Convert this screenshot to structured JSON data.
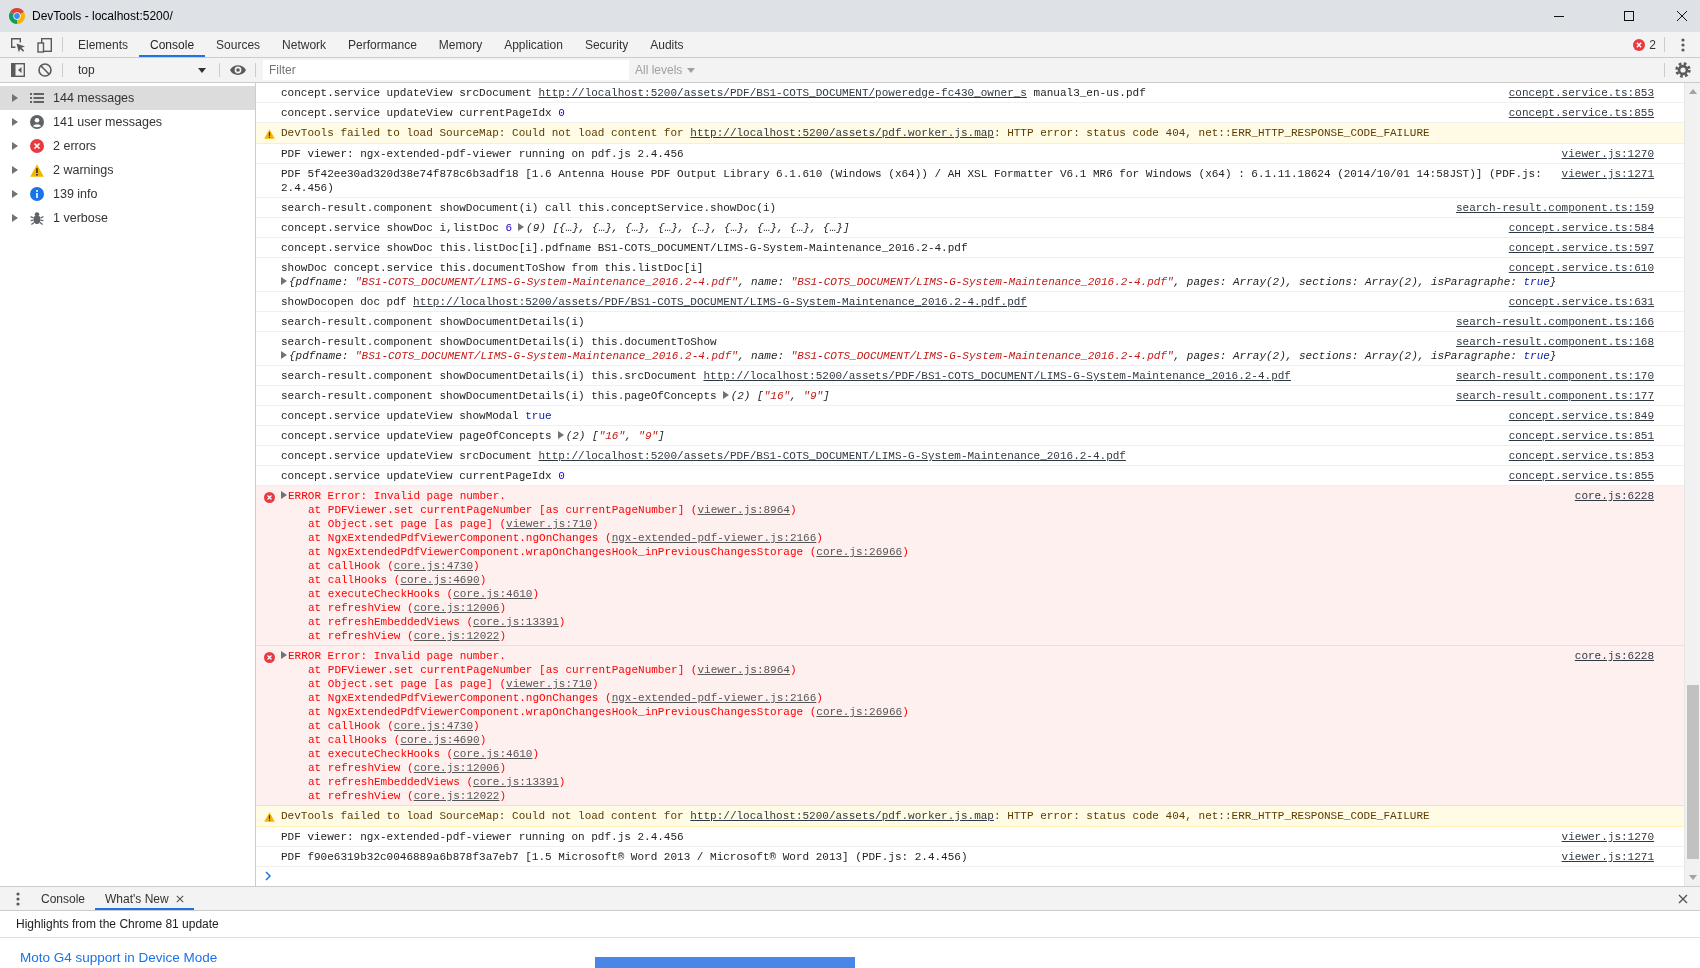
{
  "window": {
    "title": "DevTools - localhost:5200/"
  },
  "tabs": [
    {
      "label": "Elements",
      "selected": false
    },
    {
      "label": "Console",
      "selected": true
    },
    {
      "label": "Sources",
      "selected": false
    },
    {
      "label": "Network",
      "selected": false
    },
    {
      "label": "Performance",
      "selected": false
    },
    {
      "label": "Memory",
      "selected": false
    },
    {
      "label": "Application",
      "selected": false
    },
    {
      "label": "Security",
      "selected": false
    },
    {
      "label": "Audits",
      "selected": false
    }
  ],
  "error_badge": {
    "count": "2"
  },
  "toolbar": {
    "context": "top",
    "filter": {
      "placeholder": "Filter"
    },
    "levels": {
      "label": "All levels",
      "disabled": true
    }
  },
  "sidebar": {
    "items": [
      {
        "kind": "all",
        "label": "144 messages",
        "selected": true,
        "expanded": false
      },
      {
        "kind": "user",
        "label": "141 user messages",
        "selected": false,
        "expanded": false
      },
      {
        "kind": "error",
        "label": "2 errors",
        "selected": false,
        "expanded": false
      },
      {
        "kind": "warning",
        "label": "2 warnings",
        "selected": false,
        "expanded": false
      },
      {
        "kind": "info",
        "label": "139 info",
        "selected": false,
        "expanded": false
      },
      {
        "kind": "verbose",
        "label": "1 verbose",
        "selected": false,
        "expanded": false
      }
    ]
  },
  "messages": [
    {
      "kind": "log",
      "text": [
        {
          "kind": "plain",
          "text": "concept.service updateView srcDocument "
        },
        {
          "kind": "link",
          "text": "http://localhost:5200/assets/PDF/BS1-COTS_DOCUMENT/poweredge-fc430_owner_s"
        },
        {
          "kind": "plain",
          "text": " manual3_en-us.pdf"
        }
      ],
      "source": "concept.service.ts:853"
    },
    {
      "kind": "log",
      "text": [
        {
          "kind": "plain",
          "text": "concept.service updateView currentPageIdx "
        },
        {
          "kind": "number",
          "text": "0"
        }
      ],
      "source": "concept.service.ts:855"
    },
    {
      "kind": "warning",
      "text": [
        {
          "kind": "plain",
          "text": "DevTools failed to load SourceMap: Could not load content for "
        },
        {
          "kind": "link",
          "text": "http://localhost:5200/assets/pdf.worker.js.map"
        },
        {
          "kind": "plain",
          "text": ": HTTP error: status code 404, net::ERR_HTTP_RESPONSE_CODE_FAILURE"
        }
      ]
    },
    {
      "kind": "log",
      "text": [
        {
          "kind": "plain",
          "text": "PDF viewer: ngx-extended-pdf-viewer running on pdf.js 2.4.456"
        }
      ],
      "source": "viewer.js:1270"
    },
    {
      "kind": "log",
      "text": [
        {
          "kind": "plain",
          "text": "PDF 5f42ee30ad320d38e74f878c6b3adf18 [1.6 Antenna House PDF Output Library 6.1.610 (Windows (x64)) / AH XSL Formatter V6.1 MR6 for Windows (x64) : 6.1.11.18624 (2014/10/01 14:58JST)] (PDF.js: 2.4.456)"
        }
      ],
      "source": "viewer.js:1271"
    },
    {
      "kind": "log",
      "text": [
        {
          "kind": "plain",
          "text": "search-result.component showDocument(i) call this.conceptService.showDoc(i)"
        }
      ],
      "source": "search-result.component.ts:159"
    },
    {
      "kind": "log",
      "text": [
        {
          "kind": "plain",
          "text": "concept.service showDoc i,listDoc "
        },
        {
          "kind": "number",
          "text": "6"
        }
      ],
      "preview": {
        "expanded": false,
        "parts": [
          {
            "kind": "plain",
            "text": "(9) [{…}, {…}, {…}, {…}, {…}, {…}, {…}, {…}, {…}]"
          }
        ]
      },
      "source": "concept.service.ts:584"
    },
    {
      "kind": "log",
      "text": [
        {
          "kind": "plain",
          "text": "concept.service showDoc this.listDoc[i].pdfname BS1-COTS_DOCUMENT/LIMS-G-System-Maintenance_2016.2-4.pdf"
        }
      ],
      "source": "concept.service.ts:597"
    },
    {
      "kind": "log",
      "text": [
        {
          "kind": "plain",
          "text": "showDoc concept.service this.documentToShow from this.listDoc[i]"
        }
      ],
      "detail": {
        "expanded": false,
        "parts": [
          {
            "kind": "plain",
            "text": "{pdfname: "
          },
          {
            "kind": "string",
            "text": "\"BS1-COTS_DOCUMENT/LIMS-G-System-Maintenance_2016.2-4.pdf\""
          },
          {
            "kind": "plain",
            "text": ", name: "
          },
          {
            "kind": "string",
            "text": "\"BS1-COTS_DOCUMENT/LIMS-G-System-Maintenance_2016.2-4.pdf\""
          },
          {
            "kind": "plain",
            "text": ", pages: Array(2), sections: Array(2), isParagraphe: "
          },
          {
            "kind": "keyword",
            "text": "true"
          },
          {
            "kind": "plain",
            "text": "}"
          }
        ]
      },
      "source": "concept.service.ts:610"
    },
    {
      "kind": "log",
      "text": [
        {
          "kind": "plain",
          "text": "showDocopen doc pdf "
        },
        {
          "kind": "link",
          "text": "http://localhost:5200/assets/PDF/BS1-COTS_DOCUMENT/LIMS-G-System-Maintenance_2016.2-4.pdf.pdf"
        }
      ],
      "source": "concept.service.ts:631"
    },
    {
      "kind": "log",
      "text": [
        {
          "kind": "plain",
          "text": "search-result.component showDocumentDetails(i)"
        }
      ],
      "source": "search-result.component.ts:166"
    },
    {
      "kind": "log",
      "text": [
        {
          "kind": "plain",
          "text": "search-result.component showDocumentDetails(i) this.documentToShow"
        }
      ],
      "detail": {
        "expanded": false,
        "parts": [
          {
            "kind": "plain",
            "text": "{pdfname: "
          },
          {
            "kind": "string",
            "text": "\"BS1-COTS_DOCUMENT/LIMS-G-System-Maintenance_2016.2-4.pdf\""
          },
          {
            "kind": "plain",
            "text": ", name: "
          },
          {
            "kind": "string",
            "text": "\"BS1-COTS_DOCUMENT/LIMS-G-System-Maintenance_2016.2-4.pdf\""
          },
          {
            "kind": "plain",
            "text": ", pages: Array(2), sections: Array(2), isParagraphe: "
          },
          {
            "kind": "keyword",
            "text": "true"
          },
          {
            "kind": "plain",
            "text": "}"
          }
        ]
      },
      "source": "search-result.component.ts:168"
    },
    {
      "kind": "log",
      "text": [
        {
          "kind": "plain",
          "text": "search-result.component showDocumentDetails(i) this.srcDocument "
        },
        {
          "kind": "link",
          "text": "http://localhost:5200/assets/PDF/BS1-COTS_DOCUMENT/LIMS-G-System-Maintenance_2016.2-4.pdf"
        }
      ],
      "source": "search-result.component.ts:170"
    },
    {
      "kind": "log",
      "text": [
        {
          "kind": "plain",
          "text": "search-result.component showDocumentDetails(i) this.pageOfConcepts"
        }
      ],
      "preview": {
        "expanded": false,
        "parts": [
          {
            "kind": "plain",
            "text": "(2) ["
          },
          {
            "kind": "string",
            "text": "\"16\""
          },
          {
            "kind": "plain",
            "text": ", "
          },
          {
            "kind": "string",
            "text": "\"9\""
          },
          {
            "kind": "plain",
            "text": "]"
          }
        ]
      },
      "source": "search-result.component.ts:177"
    },
    {
      "kind": "log",
      "text": [
        {
          "kind": "plain",
          "text": "concept.service updateView showModal "
        },
        {
          "kind": "keyword",
          "text": "true"
        }
      ],
      "source": "concept.service.ts:849"
    },
    {
      "kind": "log",
      "text": [
        {
          "kind": "plain",
          "text": "concept.service updateView pageOfConcepts"
        }
      ],
      "preview": {
        "expanded": false,
        "parts": [
          {
            "kind": "plain",
            "text": "(2) ["
          },
          {
            "kind": "string",
            "text": "\"16\""
          },
          {
            "kind": "plain",
            "text": ", "
          },
          {
            "kind": "string",
            "text": "\"9\""
          },
          {
            "kind": "plain",
            "text": "]"
          }
        ]
      },
      "source": "concept.service.ts:851"
    },
    {
      "kind": "log",
      "text": [
        {
          "kind": "plain",
          "text": "concept.service updateView srcDocument "
        },
        {
          "kind": "link",
          "text": "http://localhost:5200/assets/PDF/BS1-COTS_DOCUMENT/LIMS-G-System-Maintenance_2016.2-4.pdf"
        }
      ],
      "source": "concept.service.ts:853"
    },
    {
      "kind": "log",
      "text": [
        {
          "kind": "plain",
          "text": "concept.service updateView currentPageIdx "
        },
        {
          "kind": "number",
          "text": "0"
        }
      ],
      "source": "concept.service.ts:855"
    },
    {
      "kind": "error",
      "expanded": false,
      "text": [
        {
          "kind": "plain",
          "text": "ERROR Error: Invalid page number."
        }
      ],
      "source": "core.js:6228",
      "stack": [
        [
          {
            "kind": "plain",
            "text": "at PDFViewer.set currentPageNumber [as currentPageNumber] ("
          },
          {
            "kind": "link",
            "text": "viewer.js:8964"
          },
          {
            "kind": "plain",
            "text": ")"
          }
        ],
        [
          {
            "kind": "plain",
            "text": "at Object.set page [as page] ("
          },
          {
            "kind": "link",
            "text": "viewer.js:710"
          },
          {
            "kind": "plain",
            "text": ")"
          }
        ],
        [
          {
            "kind": "plain",
            "text": "at NgxExtendedPdfViewerComponent.ngOnChanges ("
          },
          {
            "kind": "link",
            "text": "ngx-extended-pdf-viewer.js:2166"
          },
          {
            "kind": "plain",
            "text": ")"
          }
        ],
        [
          {
            "kind": "plain",
            "text": "at NgxExtendedPdfViewerComponent.wrapOnChangesHook_inPreviousChangesStorage ("
          },
          {
            "kind": "link",
            "text": "core.js:26966"
          },
          {
            "kind": "plain",
            "text": ")"
          }
        ],
        [
          {
            "kind": "plain",
            "text": "at callHook ("
          },
          {
            "kind": "link",
            "text": "core.js:4730"
          },
          {
            "kind": "plain",
            "text": ")"
          }
        ],
        [
          {
            "kind": "plain",
            "text": "at callHooks ("
          },
          {
            "kind": "link",
            "text": "core.js:4690"
          },
          {
            "kind": "plain",
            "text": ")"
          }
        ],
        [
          {
            "kind": "plain",
            "text": "at executeCheckHooks ("
          },
          {
            "kind": "link",
            "text": "core.js:4610"
          },
          {
            "kind": "plain",
            "text": ")"
          }
        ],
        [
          {
            "kind": "plain",
            "text": "at refreshView ("
          },
          {
            "kind": "link",
            "text": "core.js:12006"
          },
          {
            "kind": "plain",
            "text": ")"
          }
        ],
        [
          {
            "kind": "plain",
            "text": "at refreshEmbeddedViews ("
          },
          {
            "kind": "link",
            "text": "core.js:13391"
          },
          {
            "kind": "plain",
            "text": ")"
          }
        ],
        [
          {
            "kind": "plain",
            "text": "at refreshView ("
          },
          {
            "kind": "link",
            "text": "core.js:12022"
          },
          {
            "kind": "plain",
            "text": ")"
          }
        ]
      ]
    },
    {
      "kind": "error",
      "expanded": false,
      "text": [
        {
          "kind": "plain",
          "text": "ERROR Error: Invalid page number."
        }
      ],
      "source": "core.js:6228",
      "stack": [
        [
          {
            "kind": "plain",
            "text": "at PDFViewer.set currentPageNumber [as currentPageNumber] ("
          },
          {
            "kind": "link",
            "text": "viewer.js:8964"
          },
          {
            "kind": "plain",
            "text": ")"
          }
        ],
        [
          {
            "kind": "plain",
            "text": "at Object.set page [as page] ("
          },
          {
            "kind": "link",
            "text": "viewer.js:710"
          },
          {
            "kind": "plain",
            "text": ")"
          }
        ],
        [
          {
            "kind": "plain",
            "text": "at NgxExtendedPdfViewerComponent.ngOnChanges ("
          },
          {
            "kind": "link",
            "text": "ngx-extended-pdf-viewer.js:2166"
          },
          {
            "kind": "plain",
            "text": ")"
          }
        ],
        [
          {
            "kind": "plain",
            "text": "at NgxExtendedPdfViewerComponent.wrapOnChangesHook_inPreviousChangesStorage ("
          },
          {
            "kind": "link",
            "text": "core.js:26966"
          },
          {
            "kind": "plain",
            "text": ")"
          }
        ],
        [
          {
            "kind": "plain",
            "text": "at callHook ("
          },
          {
            "kind": "link",
            "text": "core.js:4730"
          },
          {
            "kind": "plain",
            "text": ")"
          }
        ],
        [
          {
            "kind": "plain",
            "text": "at callHooks ("
          },
          {
            "kind": "link",
            "text": "core.js:4690"
          },
          {
            "kind": "plain",
            "text": ")"
          }
        ],
        [
          {
            "kind": "plain",
            "text": "at executeCheckHooks ("
          },
          {
            "kind": "link",
            "text": "core.js:4610"
          },
          {
            "kind": "plain",
            "text": ")"
          }
        ],
        [
          {
            "kind": "plain",
            "text": "at refreshView ("
          },
          {
            "kind": "link",
            "text": "core.js:12006"
          },
          {
            "kind": "plain",
            "text": ")"
          }
        ],
        [
          {
            "kind": "plain",
            "text": "at refreshEmbeddedViews ("
          },
          {
            "kind": "link",
            "text": "core.js:13391"
          },
          {
            "kind": "plain",
            "text": ")"
          }
        ],
        [
          {
            "kind": "plain",
            "text": "at refreshView ("
          },
          {
            "kind": "link",
            "text": "core.js:12022"
          },
          {
            "kind": "plain",
            "text": ")"
          }
        ]
      ]
    },
    {
      "kind": "warning",
      "text": [
        {
          "kind": "plain",
          "text": "DevTools failed to load SourceMap: Could not load content for "
        },
        {
          "kind": "link",
          "text": "http://localhost:5200/assets/pdf.worker.js.map"
        },
        {
          "kind": "plain",
          "text": ": HTTP error: status code 404, net::ERR_HTTP_RESPONSE_CODE_FAILURE"
        }
      ]
    },
    {
      "kind": "log",
      "text": [
        {
          "kind": "plain",
          "text": "PDF viewer: ngx-extended-pdf-viewer running on pdf.js 2.4.456"
        }
      ],
      "source": "viewer.js:1270"
    },
    {
      "kind": "log",
      "text": [
        {
          "kind": "plain",
          "text": "PDF f90e6319b32c0046889a6b878f3a7eb7 [1.5 Microsoft® Word 2013 / Microsoft® Word 2013] (PDF.js: 2.4.456)"
        }
      ],
      "source": "viewer.js:1271"
    }
  ],
  "drawer": {
    "tabs": [
      {
        "label": "Console",
        "selected": false,
        "closable": false
      },
      {
        "label": "What's New",
        "selected": true,
        "closable": true
      }
    ],
    "heading": "Highlights from the Chrome 81 update",
    "link": "Moto G4 support in Device Mode"
  }
}
